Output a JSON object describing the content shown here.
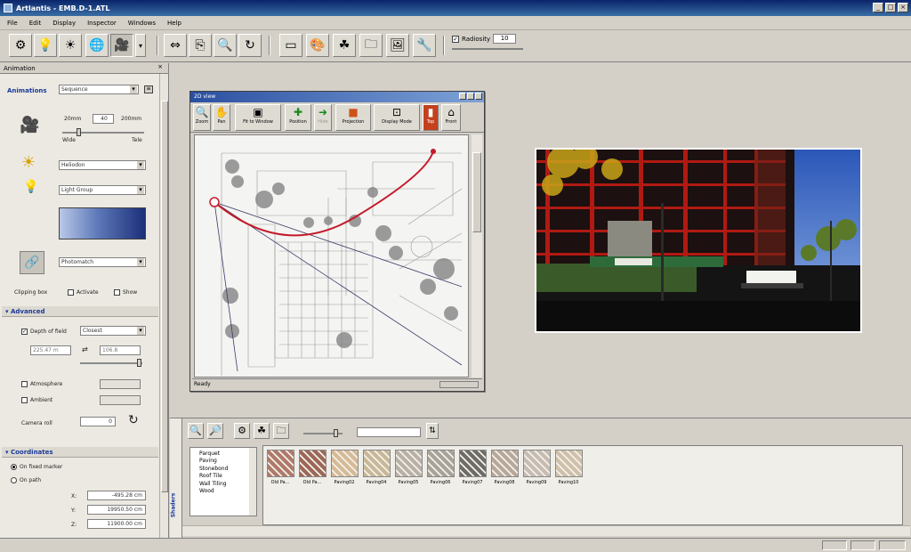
{
  "window": {
    "title": "Artlantis - EMB.D-1.ATL"
  },
  "menu": [
    "File",
    "Edit",
    "Display",
    "Inspector",
    "Windows",
    "Help"
  ],
  "toolbar": {
    "icons": [
      "render-icon",
      "light-icon",
      "sun-icon",
      "globe-icon",
      "camera-icon",
      "dropdown-icon",
      "aspect-icon",
      "export-icon",
      "zoom-icon",
      "refresh-icon",
      "window-icon",
      "material-icon",
      "object-icon",
      "folder-icon",
      "photo-icon",
      "settings-icon"
    ],
    "radiosity_label": "Radiosity",
    "radiosity_value": "10"
  },
  "left_panel": {
    "title": "Animation",
    "animations_label": "Animations",
    "animations_value": "Sequence",
    "zoom_small": "20mm",
    "zoom_value": "40",
    "zoom_large": "200mm",
    "wide": "Wide",
    "tele": "Tele",
    "heliodon": "Heliodon",
    "light_group": "Light Group",
    "photomatch": "Photomatch",
    "clipping_box": "Clipping box",
    "activate": "Activate",
    "show": "Show",
    "advanced": "Advanced",
    "depth_of_field": "Depth of field",
    "depth_value": "Closest",
    "depth_left": "225.47 m",
    "depth_right": "106.8",
    "atmosphere": "Atmosphere",
    "ambient": "Ambient",
    "camera_roll": "Camera roll",
    "camera_roll_value": "0",
    "coordinates": "Coordinates",
    "on_fixed_marker": "On fixed marker",
    "on_path": "On path",
    "x_value": "-495.28 cm",
    "y_value": "19950.50 cm",
    "z_value": "11900.00 cm"
  },
  "view2d": {
    "title": "2D view",
    "buttons": [
      "Zoom",
      "Pan",
      "Fit to Window",
      "Position",
      "Hide",
      "Projection",
      "Display Mode",
      "Top",
      "Front"
    ],
    "status": "Ready"
  },
  "shaders": {
    "label": "Shaders",
    "tree": [
      "Parquet",
      "Paving",
      "Stonebond",
      "Roof Tile",
      "Wall Tiling",
      "Wood"
    ],
    "items": [
      {
        "label": "Old Pa...",
        "color": "#b07a6a"
      },
      {
        "label": "Old Pa...",
        "color": "#9c6858"
      },
      {
        "label": "Paving02",
        "color": "#d6ba96"
      },
      {
        "label": "Paving04",
        "color": "#c8b898"
      },
      {
        "label": "Paving05",
        "color": "#b9b1a6"
      },
      {
        "label": "Paving06",
        "color": "#a8a298"
      },
      {
        "label": "Paving07",
        "color": "#6f6c68"
      },
      {
        "label": "Paving08",
        "color": "#b8a89a"
      },
      {
        "label": "Paving09",
        "color": "#c6bcb2"
      },
      {
        "label": "Paving10",
        "color": "#d0c0aa"
      }
    ]
  }
}
